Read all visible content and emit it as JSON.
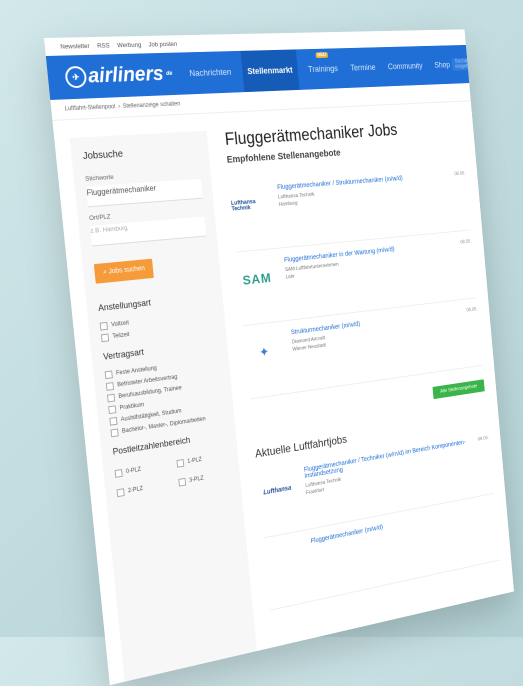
{
  "topbar": {
    "links": [
      "Newsletter",
      "RSS",
      "Werbung",
      "Job posten"
    ]
  },
  "header": {
    "logo_text": "airliners",
    "logo_sup": "de",
    "nav": [
      {
        "label": "Nachrichten",
        "active": false
      },
      {
        "label": "Stellenmarkt",
        "active": true
      },
      {
        "label": "Trainings",
        "active": false,
        "badge": "NEU"
      },
      {
        "label": "Termine",
        "active": false
      },
      {
        "label": "Community",
        "active": false
      },
      {
        "label": "Shop",
        "active": false
      }
    ],
    "search_placeholder": "Suchbegriff eingeben",
    "search_icon": "search-icon"
  },
  "breadcrumb": {
    "items": [
      "Luftfahrt-Stellenpool",
      "Stellenanzeige schalten"
    ]
  },
  "sidebar": {
    "title": "Jobsuche",
    "query_label": "Stichworte",
    "query_value": "Fluggerätmechaniker",
    "location_label": "Ort/PLZ",
    "location_placeholder": "z.B. Hamburg",
    "search_button": "Jobs suchen",
    "employment_title": "Anstellungsart",
    "employment_options": [
      "Vollzeit",
      "Teilzeit"
    ],
    "contract_title": "Vertragsart",
    "contract_options": [
      "Feste Anstellung",
      "Befristeter Arbeitsvertrag",
      "Berufsausbildung, Trainee",
      "Praktikum",
      "Aushilfstätigkeit, Studium",
      "Bachelor-, Master-, Diplomarbeiten"
    ],
    "zip_title": "Postleitzahlenbereich",
    "zip_options": [
      "0-PLZ",
      "1-PLZ",
      "2-PLZ",
      "3-PLZ"
    ]
  },
  "main": {
    "title": "Fluggerätmechaniker Jobs",
    "featured_title": "Empfohlene Stellenangebote",
    "featured_jobs": [
      {
        "title": "Fluggerätmechaniker / Strukturmechaniker (m/w/d)",
        "company": "Lufthansa Technik",
        "location": "Hamburg",
        "date": "08.05.",
        "logo_type": "text",
        "logo_text": "Lufthansa Technik"
      },
      {
        "title": "Fluggerätmechaniker in der Wartung (m/w/d)",
        "company": "SAM Luftfahrtunternehmen",
        "location": "Lahr",
        "date": "08.05.",
        "logo_type": "sam",
        "logo_text": "SAM"
      },
      {
        "title": "Strukturmechaniker (m/w/d)",
        "company": "Diamond Aircraft",
        "location": "Wiener Neustadt",
        "date": "08.05.",
        "logo_type": "icon",
        "logo_text": ""
      }
    ],
    "all_jobs_button": "Alle Stellenangebote",
    "latest_title": "Aktuelle Luftfahrtjobs",
    "latest_jobs": [
      {
        "title": "Fluggerätmechaniker / Techniker (w/m/d) im Bereich Komponenten-Instandsetzung",
        "company": "Lufthansa Technik",
        "location": "Frankfurt",
        "date": "08.05.",
        "logo_text": "Lufthansa"
      },
      {
        "title": "Fluggerätmechaniker (m/w/d)",
        "company": "",
        "location": "",
        "date": "",
        "logo_text": ""
      }
    ]
  }
}
